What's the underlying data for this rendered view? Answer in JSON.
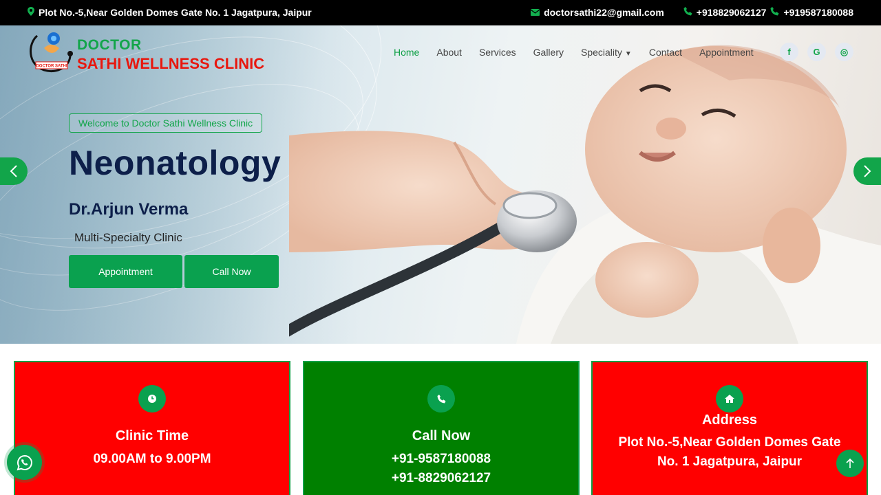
{
  "topbar": {
    "address": "Plot No.-5,Near Golden Domes Gate No. 1 Jagatpura, Jaipur",
    "email": "doctorsathi22@gmail.com",
    "phone1": "+918829062127",
    "phone2": "+919587180088"
  },
  "brand": {
    "line1": "DOCTOR",
    "line2": "SATHI WELLNESS CLINIC",
    "logo_text": "DOCTOR SATHI"
  },
  "nav": {
    "items": [
      "Home",
      "About",
      "Services",
      "Gallery",
      "Speciality",
      "Contact",
      "Appointment"
    ],
    "active": "Home"
  },
  "social": {
    "facebook": "f",
    "google": "G",
    "instagram": "◎"
  },
  "hero": {
    "welcome": "Welcome to Doctor Sathi Wellness Clinic",
    "headline": "Neonatology",
    "doctor": "Dr.Arjun Verma",
    "subtitle": "Multi-Specialty Clinic",
    "btn_appointment": "Appointment",
    "btn_call": "Call Now"
  },
  "cards": [
    {
      "title": "Clinic Time",
      "lines": [
        "09.00AM to 9.00PM"
      ],
      "icon": "clock-icon",
      "color": "#ff0000"
    },
    {
      "title": "Call Now",
      "lines": [
        "+91-9587180088",
        "+91-8829062127"
      ],
      "icon": "phone-icon",
      "color": "#008000"
    },
    {
      "title": "Address",
      "lines": [
        "Plot No.-5,Near Golden Domes Gate",
        "No. 1 Jagatpura, Jaipur"
      ],
      "icon": "home-icon",
      "color": "#ff0000"
    }
  ],
  "colors": {
    "accent": "#0aa14f",
    "brand_red": "#e8170e",
    "navy": "#0d1f4a"
  }
}
